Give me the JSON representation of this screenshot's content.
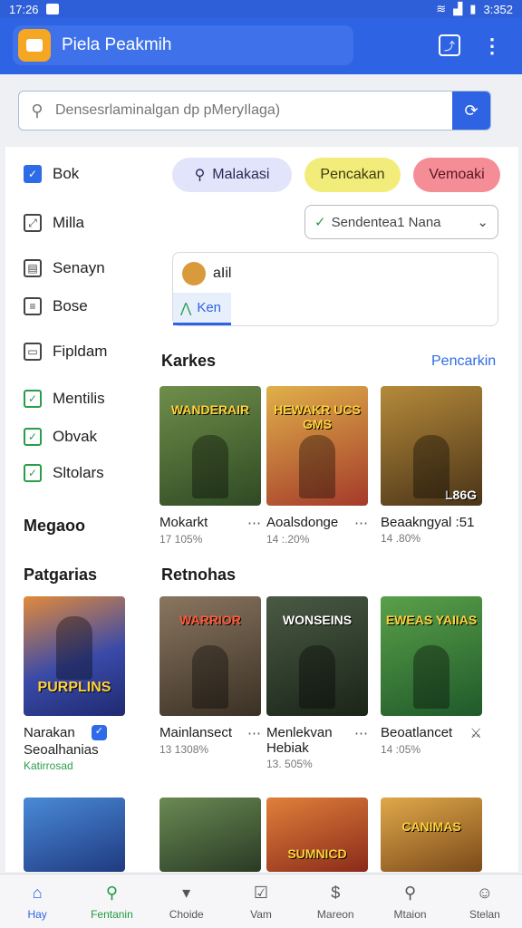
{
  "status": {
    "time": "17:26",
    "right_time": "3:352"
  },
  "appbar": {
    "title": "Piela Peakmih"
  },
  "search": {
    "placeholder": "Densesrlaminalgan dp pMeryIlaga)"
  },
  "sidebar": {
    "items": [
      {
        "label": "Bok"
      },
      {
        "label": "Milla"
      },
      {
        "label": "Senayn"
      },
      {
        "label": "Bose"
      },
      {
        "label": "Fipldam"
      },
      {
        "label": "Mentilis"
      },
      {
        "label": "Obvak"
      },
      {
        "label": "Sltolars"
      }
    ],
    "heading": "Megaoo",
    "heading2": "Patgarias"
  },
  "chips": [
    "Malakasi",
    "Pencakan",
    "Vemoaki"
  ],
  "dropdown": {
    "value": "Sendentea1 Nana"
  },
  "user_card": {
    "name": "aIil",
    "tag": "Ken"
  },
  "sections": {
    "karkes": {
      "title": "Karkes",
      "link": "Pencarkin"
    },
    "retnohas": {
      "title": "Retnohas"
    }
  },
  "cards_row1": [
    {
      "caption": "WANDERAIR",
      "title": "Mokarkt",
      "sub": "17 105%",
      "color": "#4f6b3a"
    },
    {
      "caption": "HEWAKR UCS GMS",
      "title": "Aoalsdonge",
      "sub": "14 :.20%",
      "color": "#b0503a"
    },
    {
      "caption": "L86G",
      "title": "Beaakngyal :51",
      "sub": "14 .80%",
      "color": "#7a5a2a"
    }
  ],
  "featured": {
    "caption": "PURPLINS",
    "title": "Narakan",
    "sub": "Seoalhanias",
    "sub2": "Katirrosad",
    "color": "#3a4aa8"
  },
  "cards_row2": [
    {
      "caption": "WARRIOR",
      "title": "Mainlansect",
      "sub": "13 1308%",
      "color": "#6b5a44"
    },
    {
      "caption": "WONSEINS",
      "title": "Menlekvan Hebiak",
      "sub": "13. 505%",
      "color": "#33422e"
    },
    {
      "caption": "EWEAS YAIIAS",
      "title": "Beoatlancet",
      "sub": "14 :05%",
      "color": "#3d7a3a"
    }
  ],
  "cards_row3": [
    {
      "caption": "",
      "color": "#2a5aa8"
    },
    {
      "caption": "",
      "color": "#4a6b3a"
    },
    {
      "caption": "SUMNICD",
      "color": "#b0482a"
    },
    {
      "caption": "CANIMAS",
      "color": "#a0752a"
    }
  ],
  "nav": [
    {
      "label": "Hay",
      "icon": "home-icon"
    },
    {
      "label": "Fentanin",
      "icon": "search-icon"
    },
    {
      "label": "Choide",
      "icon": "bookmark-icon"
    },
    {
      "label": "Vam",
      "icon": "check-icon"
    },
    {
      "label": "Mareon",
      "icon": "dollar-icon"
    },
    {
      "label": "Mtaion",
      "icon": "search-alert-icon"
    },
    {
      "label": "Stelan",
      "icon": "profile-icon"
    }
  ]
}
